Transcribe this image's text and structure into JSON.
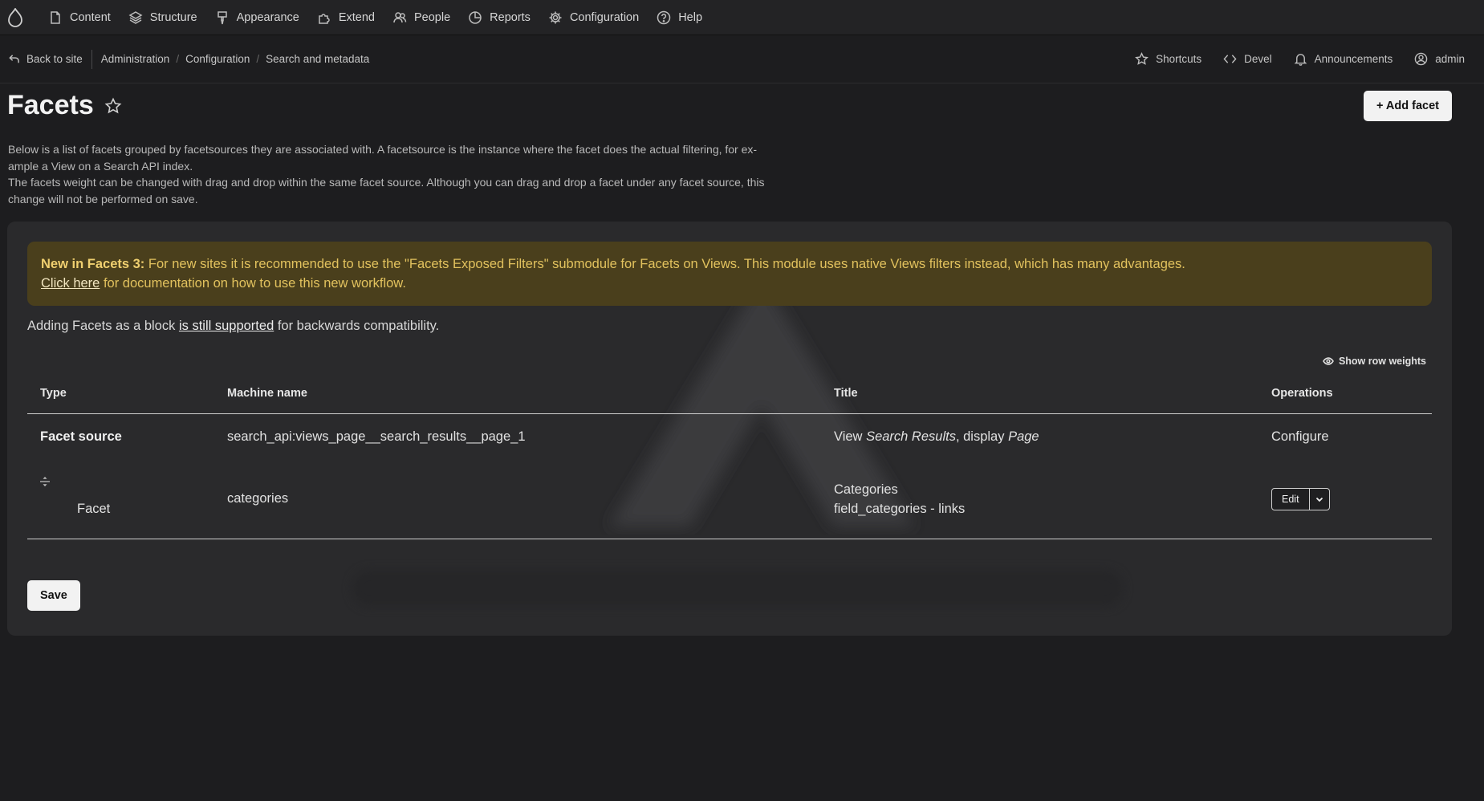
{
  "toolbar": {
    "items": [
      {
        "label": "Content",
        "icon": "content-icon"
      },
      {
        "label": "Structure",
        "icon": "structure-icon"
      },
      {
        "label": "Appearance",
        "icon": "appearance-icon"
      },
      {
        "label": "Extend",
        "icon": "extend-icon"
      },
      {
        "label": "People",
        "icon": "people-icon"
      },
      {
        "label": "Reports",
        "icon": "reports-icon"
      },
      {
        "label": "Configuration",
        "icon": "configuration-icon"
      },
      {
        "label": "Help",
        "icon": "help-icon"
      }
    ]
  },
  "secondary": {
    "back": "Back to site",
    "breadcrumb": [
      "Administration",
      "Configuration",
      "Search and metadata"
    ],
    "separator": "/",
    "right": [
      "Shortcuts",
      "Devel",
      "Announcements",
      "admin"
    ]
  },
  "page": {
    "title": "Facets",
    "add_button": "+ Add facet",
    "description_1": "Below is a list of facets grouped by facetsources they are associated with. A facetsource is the instance where the facet does the actual filtering, for ex-ample a View on a Search API index.",
    "description_1a": "Below is a list of facets grouped by facetsources they are associated with. A facetsource is the instance where the facet does the actual filtering, for ex-",
    "description_1b": "ample a View on a Search API index.",
    "description_2a": "The facets weight can be changed with drag and drop within the same facet source. Although you can drag and drop a facet under any facet source, this",
    "description_2b": "change will not be performed on save."
  },
  "notice": {
    "bold": "New in Facets 3:",
    "text": " For new sites it is recommended to use the \"Facets Exposed Filters\" submodule for Facets on Views. This module uses native Views filters instead, which has many advantages.",
    "link": "Click here",
    "link_rest": " for documentation on how to use this new workflow."
  },
  "compat": {
    "before": "Adding Facets as a block ",
    "link": "is still supported",
    "after": " for backwards compatibility."
  },
  "show_row_weights": "Show row weights",
  "table": {
    "headers": [
      "Type",
      "Machine name",
      "Title",
      "Operations"
    ],
    "source_row": {
      "type": "Facet source",
      "machine": "search_api:views_page__search_results__page_1",
      "title_prefix": "View ",
      "title_view": "Search Results",
      "title_mid": ", display ",
      "title_display": "Page",
      "operation": "Configure"
    },
    "facet_row": {
      "type": "Facet",
      "machine": "categories",
      "title": "Categories",
      "subtitle": "field_categories - links",
      "edit": "Edit"
    }
  },
  "save_button": "Save",
  "colors": {
    "notice_bg": "#4a3f1c",
    "notice_text": "#e2c25e",
    "panel_bg": "#2a2a2c",
    "page_bg": "#1d1d1f"
  }
}
